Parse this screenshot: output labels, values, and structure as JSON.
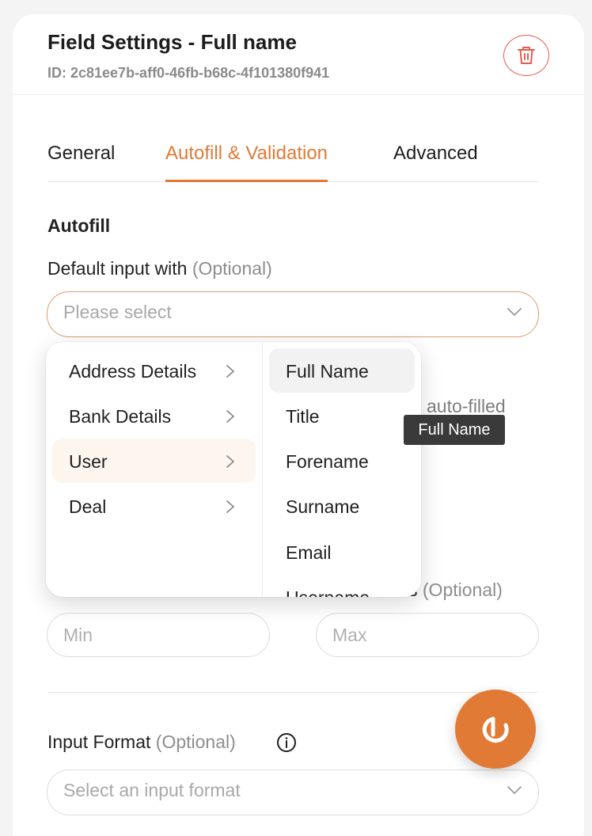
{
  "header": {
    "title": "Field Settings - Full name",
    "field_id": "ID: 2c81ee7b-aff0-46fb-b68c-4f101380f941"
  },
  "tabs": [
    {
      "label": "General",
      "active": false
    },
    {
      "label": "Autofill & Validation",
      "active": true
    },
    {
      "label": "Advanced",
      "active": false
    }
  ],
  "autofill": {
    "section_label": "Autofill",
    "default_input_label": "Default input with",
    "optional_text": "(Optional)",
    "select_placeholder": "Please select"
  },
  "background_text": {
    "autofilled_fragment": "auto-filled",
    "length_suffix_fragment": "s"
  },
  "length": {
    "min_placeholder": "Min",
    "max_placeholder": "Max",
    "optional_text": "(Optional)"
  },
  "input_format": {
    "label": "Input Format",
    "optional_text": "(Optional)",
    "placeholder": "Select an input format"
  },
  "dropdown": {
    "categories": [
      {
        "label": "Address Details",
        "active": false
      },
      {
        "label": "Bank Details",
        "active": false
      },
      {
        "label": "User",
        "active": true
      },
      {
        "label": "Deal",
        "active": false
      }
    ],
    "sub_items": [
      {
        "label": "Full Name",
        "active": true
      },
      {
        "label": "Title",
        "active": false
      },
      {
        "label": "Forename",
        "active": false
      },
      {
        "label": "Surname",
        "active": false
      },
      {
        "label": "Email",
        "active": false
      },
      {
        "label": "Username",
        "active": false
      }
    ]
  },
  "tooltip": {
    "text": "Full Name"
  },
  "colors": {
    "accent": "#e07a34",
    "danger": "#e35a4f",
    "tooltip_bg": "#3a3a3a",
    "active_category_bg": "#fdf6ee"
  }
}
